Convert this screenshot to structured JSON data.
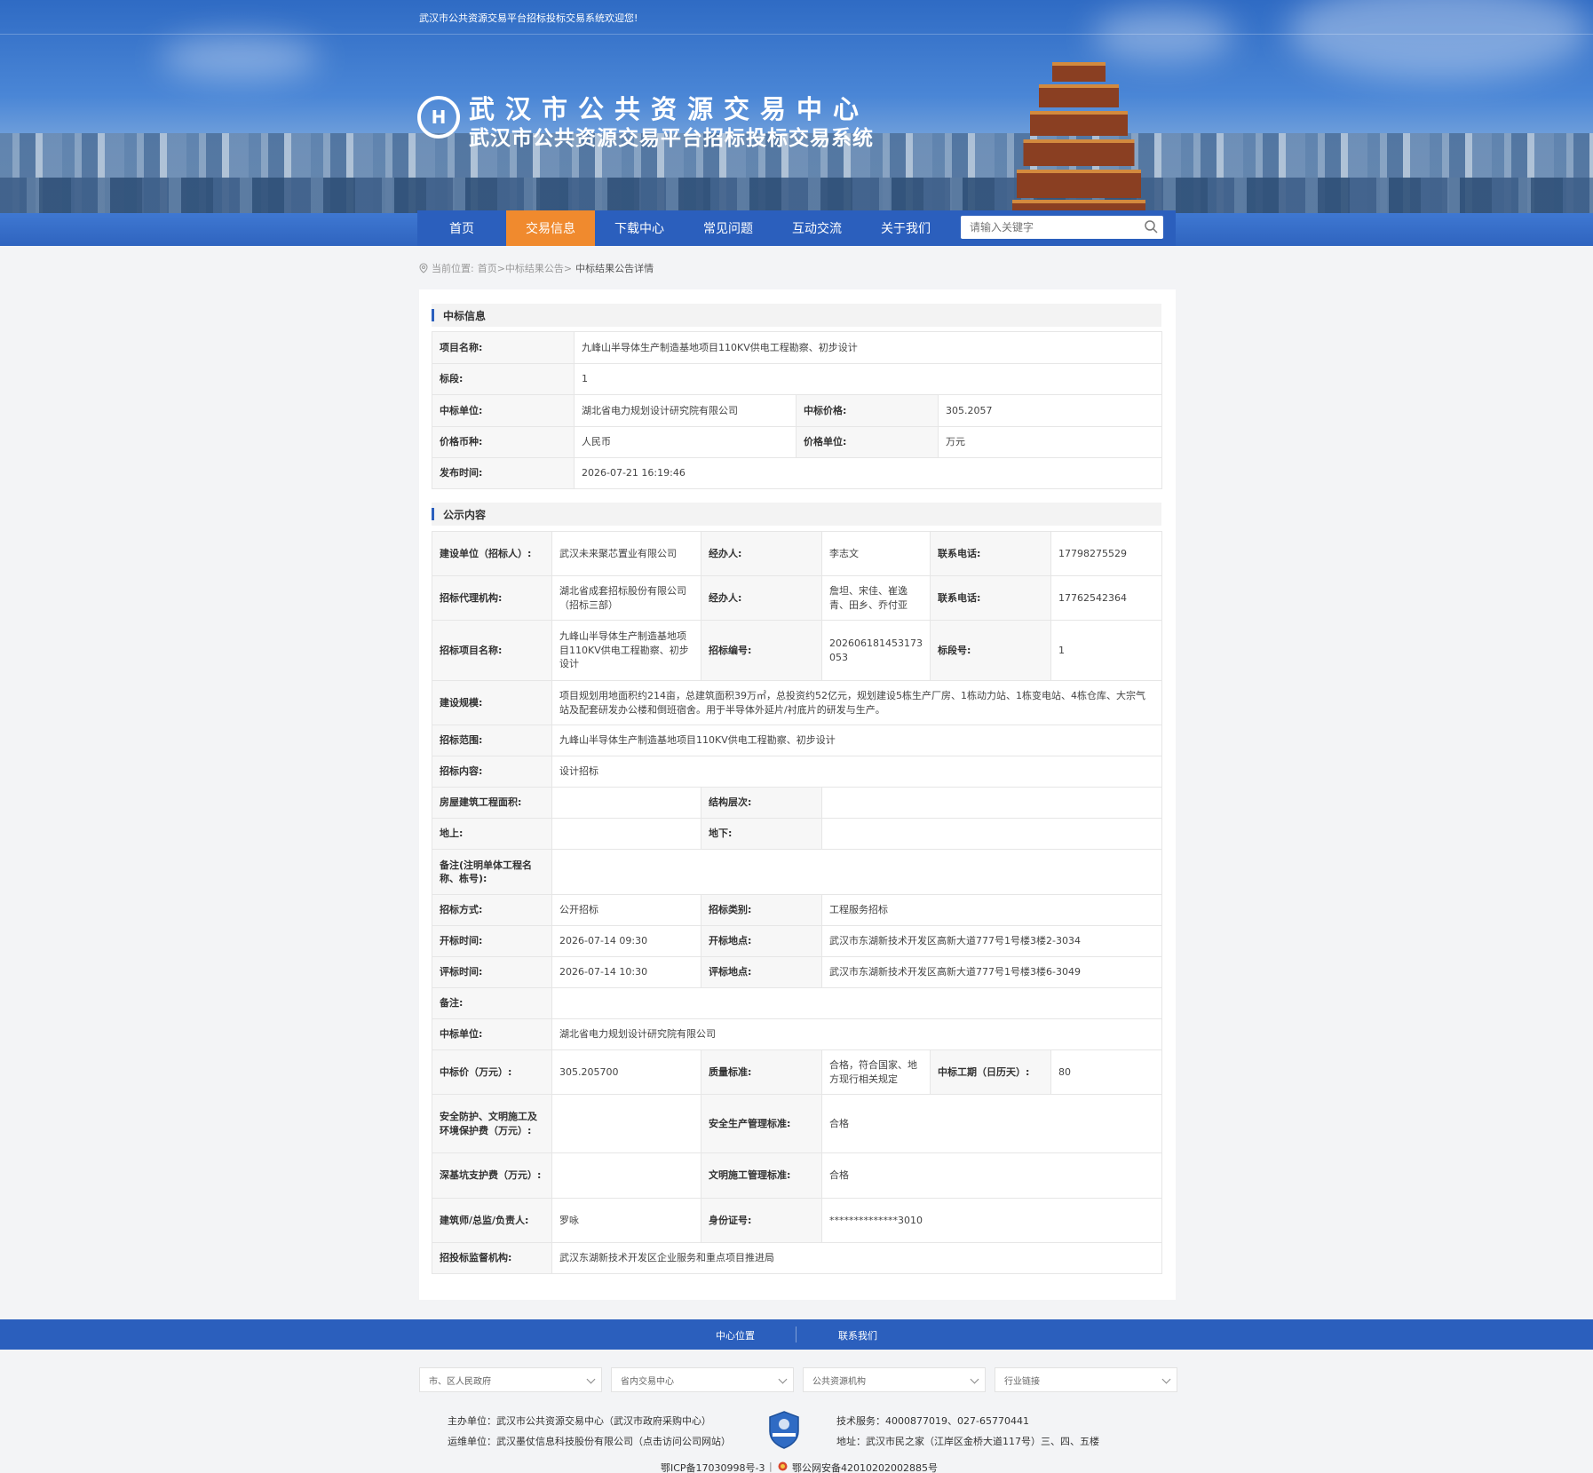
{
  "header": {
    "welcome": "武汉市公共资源交易平台招标投标交易系统欢迎您!",
    "logo_text": "H",
    "title_main": "武汉市公共资源交易中心",
    "title_sub": "武汉市公共资源交易平台招标投标交易系统"
  },
  "nav": {
    "items": [
      "首页",
      "交易信息",
      "下载中心",
      "常见问题",
      "互动交流",
      "关于我们"
    ],
    "active_index": 1,
    "search_placeholder": "请输入关键字"
  },
  "breadcrumb": {
    "prefix": "当前位置:",
    "path": "首页>中标结果公告>",
    "current": "中标结果公告详情"
  },
  "section1": {
    "title": "中标信息",
    "project_name_label": "项目名称:",
    "project_name": "九峰山半导体生产制造基地项目110KV供电工程勘察、初步设计",
    "lot_label": "标段:",
    "lot": "1",
    "winner_label": "中标单位:",
    "winner": "湖北省电力规划设计研究院有限公司",
    "price_label": "中标价格:",
    "price": "305.2057",
    "currency_label": "价格币种:",
    "currency": "人民币",
    "unit_label": "价格单位:",
    "unit": "万元",
    "publish_label": "发布时间:",
    "publish_time": "2026-07-21 16:19:46"
  },
  "section2": {
    "title": "公示内容",
    "r1": {
      "k1": "建设单位（招标人）:",
      "v1": "武汉未来聚芯置业有限公司",
      "k2": "经办人:",
      "v2": "李志文",
      "k3": "联系电话:",
      "v3": "17798275529"
    },
    "r2": {
      "k1": "招标代理机构:",
      "v1": "湖北省成套招标股份有限公司（招标三部）",
      "k2": "经办人:",
      "v2": "詹坦、宋佳、崔逸青、田乡、乔付亚",
      "k3": "联系电话:",
      "v3": "17762542364"
    },
    "r3": {
      "k1": "招标项目名称:",
      "v1": "九峰山半导体生产制造基地项目110KV供电工程勘察、初步设计",
      "k2": "招标编号:",
      "v2": "202606181453173053",
      "k3": "标段号:",
      "v3": "1"
    },
    "scale_label": "建设规模:",
    "scale": "项目规划用地面积约214亩，总建筑面积39万㎡，总投资约52亿元，规划建设5栋生产厂房、1栋动力站、1栋变电站、4栋仓库、大宗气站及配套研发办公楼和倒班宿舍。用于半导体外延片/衬底片的研发与生产。",
    "scope_label": "招标范围:",
    "scope": "九峰山半导体生产制造基地项目110KV供电工程勘察、初步设计",
    "content_label": "招标内容:",
    "content": "设计招标",
    "area_label": "房屋建筑工程面积:",
    "area": "",
    "floors_label": "结构层次:",
    "floors": "",
    "above_label": "地上:",
    "above": "",
    "below_label": "地下:",
    "below": "",
    "remark1_label": "备注(注明单体工程名称、栋号):",
    "remark1": "",
    "method_label": "招标方式:",
    "method": "公开招标",
    "category_label": "招标类别:",
    "category": "工程服务招标",
    "open_time_label": "开标时间:",
    "open_time": "2026-07-14 09:30",
    "open_place_label": "开标地点:",
    "open_place": "武汉市东湖新技术开发区高新大道777号1号楼3楼2-3034",
    "eval_time_label": "评标时间:",
    "eval_time": "2026-07-14 10:30",
    "eval_place_label": "评标地点:",
    "eval_place": "武汉市东湖新技术开发区高新大道777号1号楼3楼6-3049",
    "remark2_label": "备注:",
    "remark2": "",
    "winner_label": "中标单位:",
    "winner": "湖北省电力规划设计研究院有限公司",
    "win_price_label": "中标价（万元）:",
    "win_price": "305.205700",
    "quality_label": "质量标准:",
    "quality": "合格，符合国家、地方现行相关规定",
    "period_label": "中标工期（日历天）:",
    "period": "80",
    "safety_fee_label": "安全防护、文明施工及环境保护费（万元）:",
    "safety_fee": "",
    "safety_std_label": "安全生产管理标准:",
    "safety_std": "合格",
    "pit_fee_label": "深基坑支护费（万元）:",
    "pit_fee": "",
    "civil_std_label": "文明施工管理标准:",
    "civil_std": "合格",
    "architect_label": "建筑师/总监/负责人:",
    "architect": "罗咏",
    "id_label": "身份证号:",
    "id_no": "**************3010",
    "supervisor_label": "招投标监督机构:",
    "supervisor": "武汉东湖新技术开发区企业服务和重点项目推进局"
  },
  "footer": {
    "link1": "中心位置",
    "link2": "联系我们",
    "selects": [
      "市、区人民政府",
      "省内交易中心",
      "公共资源机构",
      "行业链接"
    ],
    "host": "主办单位：武汉市公共资源交易中心（武汉市政府采购中心）",
    "ops": "运维单位：武汉墨仗信息科技股份有限公司（点击访问公司网站）",
    "tech": "技术服务：4000877019、027-65770441",
    "address": "地址：武汉市民之家（江岸区金桥大道117号）三、四、五楼",
    "icp": "鄂ICP备17030998号-3",
    "police": "鄂公网安备42010202002885号"
  },
  "colors": {
    "primary": "#2b5fbd",
    "active_tab": "#f08a2e"
  }
}
